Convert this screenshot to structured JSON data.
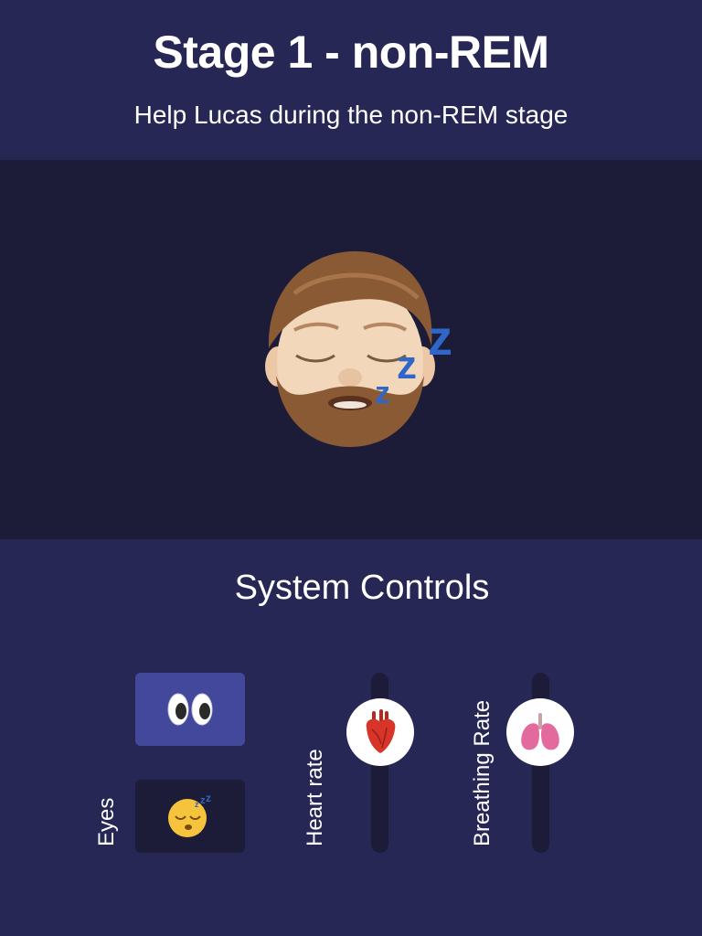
{
  "header": {
    "title": "Stage 1 - non-REM",
    "subtitle": "Help Lucas during the non-REM stage"
  },
  "stage": {
    "avatar_icon": "sleeping-man-memoji-icon",
    "sleep_icon": "zzz-icon"
  },
  "controls": {
    "title": "System Controls",
    "eyes": {
      "label": "Eyes",
      "options": [
        {
          "name": "open",
          "icon": "eyes-icon",
          "active": true
        },
        {
          "name": "closed",
          "icon": "sleeping-face-icon",
          "active": false
        }
      ]
    },
    "heart_rate": {
      "label": "Heart rate",
      "icon": "anatomical-heart-icon",
      "level": 0.85
    },
    "breathing_rate": {
      "label": "Breathing Rate",
      "icon": "lungs-icon",
      "level": 0.85
    }
  },
  "colors": {
    "background": "#262754",
    "stage_background": "#1c1c38",
    "active_button": "#43489d",
    "text": "#ffffff"
  }
}
